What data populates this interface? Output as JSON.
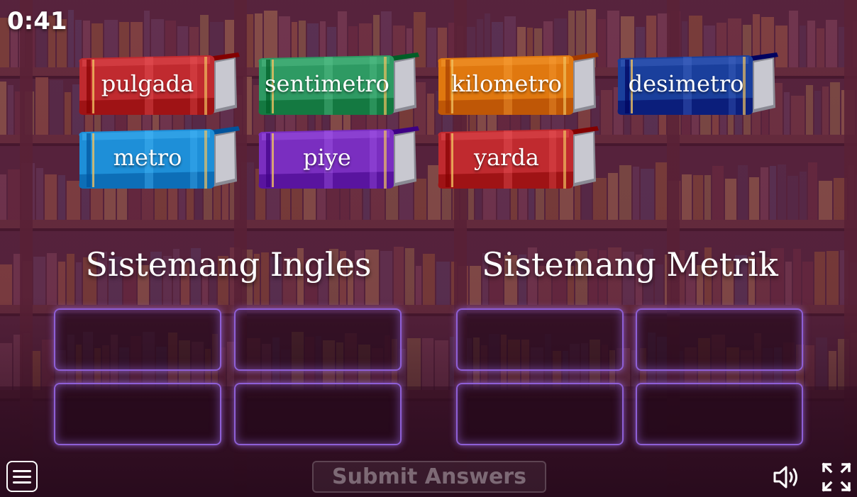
{
  "timer": "0:41",
  "books": [
    {
      "label": "pulgada",
      "color": "#c02a2f"
    },
    {
      "label": "sentimetro",
      "color": "#2e9a63"
    },
    {
      "label": "kilometro",
      "color": "#e0780f"
    },
    {
      "label": "desimetro",
      "color": "#1a3f9c"
    },
    {
      "label": "metro",
      "color": "#1e8fd8"
    },
    {
      "label": "piye",
      "color": "#7a2ec0"
    },
    {
      "label": "yarda",
      "color": "#c02a2f"
    }
  ],
  "groups": [
    {
      "title": "Sistemang Ingles",
      "slots": 4
    },
    {
      "title": "Sistemang Metrik",
      "slots": 4
    }
  ],
  "controls": {
    "submit_label": "Submit Answers",
    "menu_icon": "hamburger-menu-icon",
    "sound_icon": "speaker-volume-icon",
    "fullscreen_icon": "fullscreen-expand-icon"
  },
  "colors": {
    "background": "#4a1d33",
    "slot_border": "#8e5fd6"
  }
}
